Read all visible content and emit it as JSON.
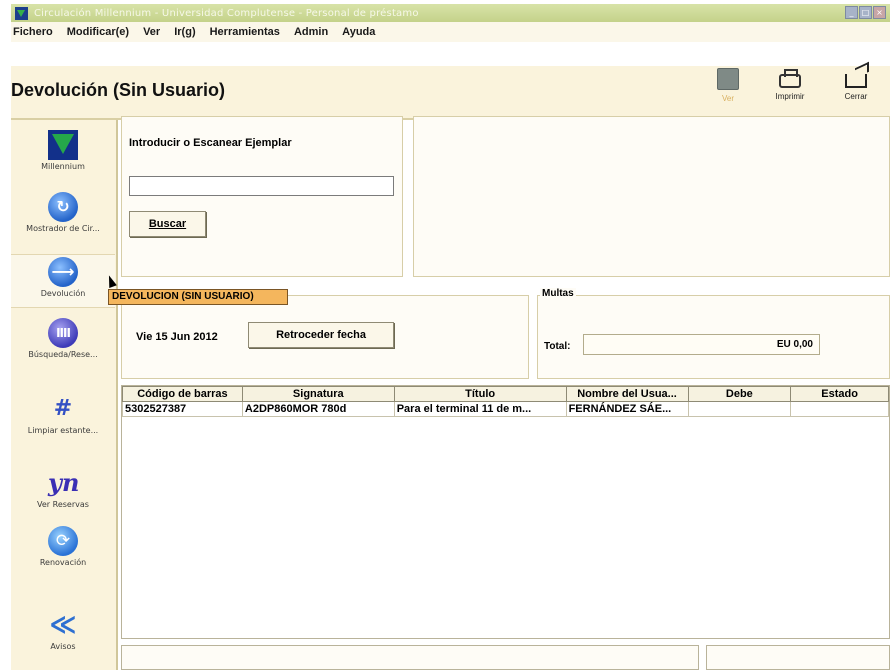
{
  "window": {
    "title": "Circulación Millennium - Universidad Complutense - Personal de préstamo"
  },
  "menu": [
    "Fichero",
    "Modificar(e)",
    "Ver",
    "Ir(g)",
    "Herramientas",
    "Admin",
    "Ayuda"
  ],
  "header": {
    "title": "Devolución (Sin Usuario)",
    "tools": {
      "ver": "Ver",
      "print": "Imprimir",
      "close": "Cerrar"
    }
  },
  "sidebar": {
    "items": [
      {
        "label": "Millennium",
        "icon": "millennium-logo-icon"
      },
      {
        "label": "Mostrador de Cir...",
        "icon": "refresh-arrow-icon"
      },
      {
        "label": "Devolución",
        "icon": "return-arrow-icon"
      },
      {
        "label": "Búsqueda/Rese...",
        "icon": "books-icon"
      },
      {
        "label": "Limpiar estante...",
        "icon": "shelf-hash-icon"
      },
      {
        "label": "Ver Reservas",
        "icon": "reserves-icon"
      },
      {
        "label": "Renovación",
        "icon": "renew-icon"
      },
      {
        "label": "Avisos",
        "icon": "notices-icon"
      }
    ]
  },
  "scan": {
    "label": "Introducir o Escanear Ejemplar",
    "value": "",
    "button": "Buscar"
  },
  "date_panel": {
    "legend": "DEVOLUCION (SIN USUARIO)",
    "date": "Vie 15 Jun 2012",
    "back_button": "Retroceder fecha"
  },
  "fines": {
    "legend": "Multas",
    "total_label": "Total:",
    "total_value": "EU 0,00"
  },
  "table": {
    "columns": [
      "Código de barras",
      "Signatura",
      "Título",
      "Nombre del Usua...",
      "Debe",
      "Estado"
    ],
    "rows": [
      [
        "5302527387",
        "A2DP860MOR 780d",
        "Para el terminal 11 de m...",
        "FERNÁNDEZ SÁE...",
        "",
        ""
      ]
    ]
  },
  "colors": {
    "accent": "#f4b65d",
    "panel_bg": "#faf3dc"
  }
}
